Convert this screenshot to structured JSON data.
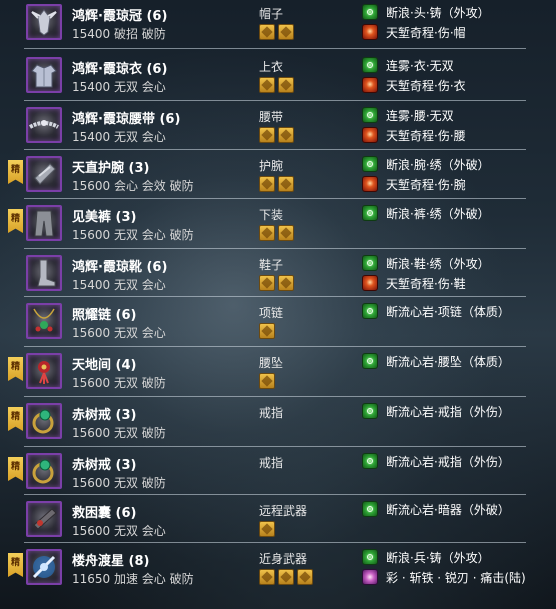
{
  "gear": [
    {
      "ribbon": "",
      "name": "鸿辉·霞琼冠 (6)",
      "stats": "15400 破招 破防",
      "slot": "帽子",
      "gems": 2,
      "enchant1": "断浪·头·铸（外攻）",
      "enchant2": "天堑奇程·伤·帽",
      "enchant2_icon": "red",
      "icon": "helmet-icon"
    },
    {
      "ribbon": "",
      "name": "鸿辉·霞琼衣 (6)",
      "stats": "15400 无双 会心",
      "slot": "上衣",
      "gems": 2,
      "enchant1": "连雾·衣·无双",
      "enchant2": "天堑奇程·伤·衣",
      "enchant2_icon": "red",
      "icon": "armor-icon"
    },
    {
      "ribbon": "",
      "name": "鸿辉·霞琼腰带 (6)",
      "stats": "15400 无双 会心",
      "slot": "腰带",
      "gems": 2,
      "enchant1": "连雾·腰·无双",
      "enchant2": "天堑奇程·伤·腰",
      "enchant2_icon": "red",
      "icon": "belt-icon"
    },
    {
      "ribbon": "精",
      "name": "天直护腕 (3)",
      "stats": "15600 会心 会效 破防",
      "slot": "护腕",
      "gems": 2,
      "enchant1": "断浪·腕·绣（外破）",
      "enchant2": "天堑奇程·伤·腕",
      "enchant2_icon": "red",
      "icon": "bracer-icon"
    },
    {
      "ribbon": "精",
      "name": "见美裤 (3)",
      "stats": "15600 无双 会心 破防",
      "slot": "下装",
      "gems": 2,
      "enchant1": "断浪·裤·绣（外破）",
      "enchant2": "",
      "enchant2_icon": "",
      "icon": "pants-icon"
    },
    {
      "ribbon": "",
      "name": "鸿辉·霞琼靴 (6)",
      "stats": "15400 无双 会心",
      "slot": "鞋子",
      "gems": 2,
      "enchant1": "断浪·鞋·绣（外攻）",
      "enchant2": "天堑奇程·伤·鞋",
      "enchant2_icon": "red",
      "icon": "boots-icon"
    },
    {
      "ribbon": "",
      "name": "照耀链 (6)",
      "stats": "15600 无双 会心",
      "slot": "项链",
      "gems": 1,
      "enchant1": "断流心岩·项链（体质）",
      "enchant2": "",
      "enchant2_icon": "",
      "icon": "necklace-icon"
    },
    {
      "ribbon": "精",
      "name": "天地间 (4)",
      "stats": "15600 无双 破防",
      "slot": "腰坠",
      "gems": 1,
      "enchant1": "断流心岩·腰坠（体质）",
      "enchant2": "",
      "enchant2_icon": "",
      "icon": "pendant-icon"
    },
    {
      "ribbon": "精",
      "name": "赤树戒 (3)",
      "stats": "15600 无双 破防",
      "slot": "戒指",
      "gems": 0,
      "enchant1": "断流心岩·戒指（外伤）",
      "enchant2": "",
      "enchant2_icon": "",
      "icon": "ring-icon"
    },
    {
      "ribbon": "精",
      "name": "赤树戒 (3)",
      "stats": "15600 无双 破防",
      "slot": "戒指",
      "gems": 0,
      "enchant1": "断流心岩·戒指（外伤）",
      "enchant2": "",
      "enchant2_icon": "",
      "icon": "ring-icon"
    },
    {
      "ribbon": "",
      "name": "救困囊 (6)",
      "stats": "15600 无双 会心",
      "slot": "远程武器",
      "gems": 1,
      "enchant1": "断流心岩·暗器（外破）",
      "enchant2": "",
      "enchant2_icon": "",
      "icon": "ranged-weapon-icon"
    },
    {
      "ribbon": "精",
      "name": "楼舟渡星 (8)",
      "stats": "11650 加速 会心 破防",
      "slot": "近身武器",
      "gems": 3,
      "enchant1": "断浪·兵·铸（外攻）",
      "enchant2": "彩 · 斩铁 · 锐刃 · 痛击(陆)",
      "enchant2_icon": "purple",
      "icon": "melee-weapon-icon"
    }
  ]
}
